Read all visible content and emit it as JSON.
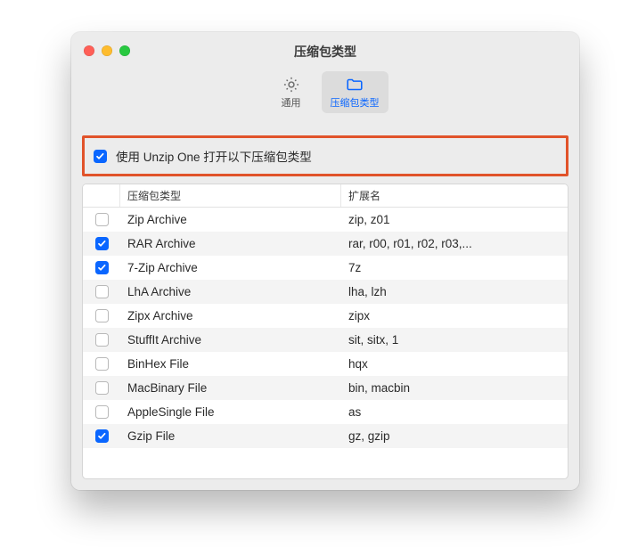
{
  "window_title": "压缩包类型",
  "tabs": {
    "general": {
      "label": "通用"
    },
    "types": {
      "label": "压缩包类型"
    }
  },
  "master_checkbox": {
    "checked": true,
    "label": "使用 Unzip One 打开以下压缩包类型"
  },
  "table": {
    "headers": {
      "type": "压缩包类型",
      "ext": "扩展名"
    },
    "rows": [
      {
        "checked": false,
        "name": "Zip Archive",
        "ext": "zip, z01"
      },
      {
        "checked": true,
        "name": "RAR Archive",
        "ext": "rar, r00, r01, r02, r03,..."
      },
      {
        "checked": true,
        "name": "7-Zip Archive",
        "ext": "7z"
      },
      {
        "checked": false,
        "name": "LhA Archive",
        "ext": "lha, lzh"
      },
      {
        "checked": false,
        "name": "Zipx Archive",
        "ext": "zipx"
      },
      {
        "checked": false,
        "name": "StuffIt Archive",
        "ext": "sit, sitx, 1"
      },
      {
        "checked": false,
        "name": "BinHex File",
        "ext": "hqx"
      },
      {
        "checked": false,
        "name": "MacBinary File",
        "ext": "bin, macbin"
      },
      {
        "checked": false,
        "name": "AppleSingle File",
        "ext": "as"
      },
      {
        "checked": true,
        "name": "Gzip File",
        "ext": "gz, gzip"
      }
    ]
  }
}
